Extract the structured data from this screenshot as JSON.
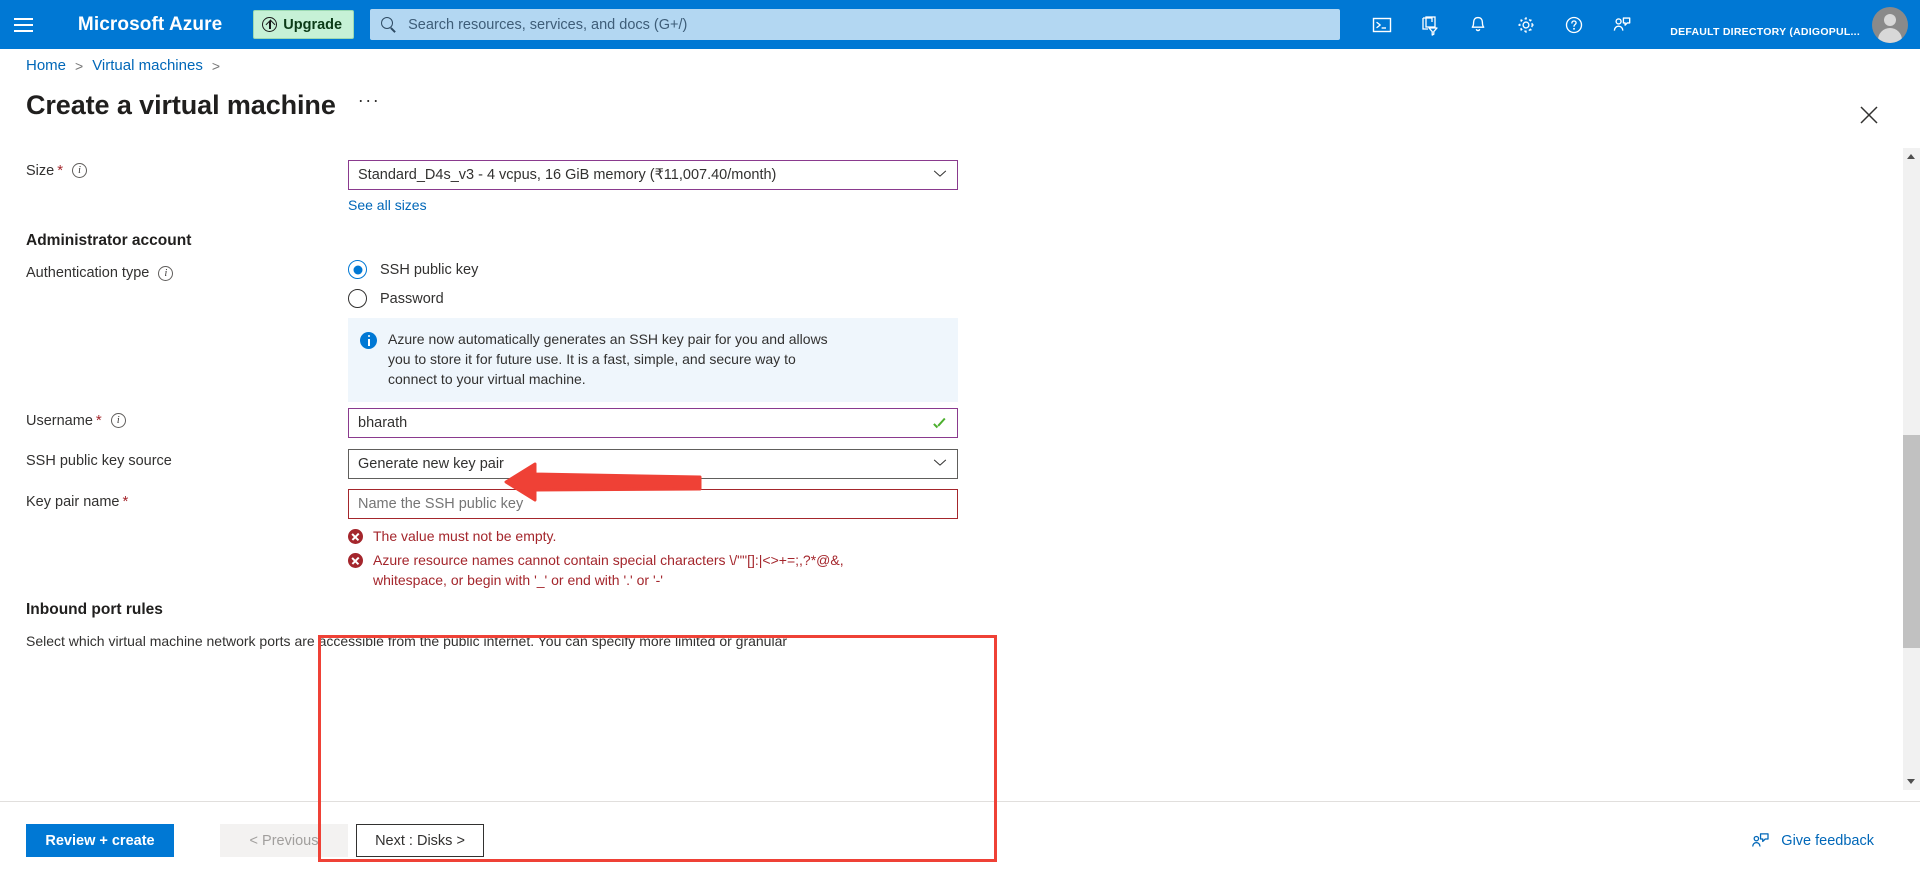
{
  "topnav": {
    "menu_icon": "hamburger-icon",
    "brand": "Microsoft Azure",
    "upgrade_label": "Upgrade",
    "search_placeholder": "Search resources, services, and docs (G+/)",
    "search_value": "",
    "icons": [
      {
        "name": "cloud-shell-icon"
      },
      {
        "name": "directories-subscriptions-icon"
      },
      {
        "name": "notifications-bell-icon"
      },
      {
        "name": "settings-gear-icon"
      },
      {
        "name": "help-question-icon"
      },
      {
        "name": "feedback-person-icon"
      }
    ],
    "directory": "DEFAULT DIRECTORY (ADIGOPUL...",
    "accent_color": "#0078d4",
    "upgrade_bg": "#c6f1d6"
  },
  "breadcrumb": {
    "items": [
      "Home",
      "Virtual machines"
    ],
    "separator": ">"
  },
  "header": {
    "title": "Create a virtual machine",
    "ellipsis": "···",
    "close_icon": "close-icon"
  },
  "form": {
    "size": {
      "label": "Size",
      "required": "*",
      "value": "Standard_D4s_v3 - 4 vcpus, 16 GiB memory (₹11,007.40/month)",
      "see_all_link": "See all sizes"
    },
    "admin_section": {
      "heading": "Administrator account",
      "auth_type_label": "Authentication type",
      "options": [
        {
          "label": "SSH public key",
          "selected": true
        },
        {
          "label": "Password",
          "selected": false
        }
      ],
      "info_message": "Azure now automatically generates an SSH key pair for you and allows you to store it for future use. It is a fast, simple, and secure way to connect to your virtual machine."
    },
    "username": {
      "label": "Username",
      "required": "*",
      "value": "bharath",
      "validation": "valid"
    },
    "ssh_source": {
      "label": "SSH public key source",
      "value": "Generate new key pair"
    },
    "key_pair_name": {
      "label": "Key pair name",
      "required": "*",
      "value": "",
      "placeholder": "Name the SSH public key",
      "errors": [
        "The value must not be empty.",
        "Azure resource names cannot contain special characters \\/\"\"[]:|<>+=;,?*@&, whitespace, or begin with '_' or end with '.' or '-'"
      ]
    },
    "inbound": {
      "heading": "Inbound port rules",
      "description": "Select which virtual machine network ports are accessible from the public internet. You can specify more limited or granular"
    }
  },
  "annotations": {
    "arrow_color": "#ef4136",
    "box_color": "#ef4136",
    "arrow_target": "SSH public key radio option",
    "box_target": "SSH key pair fields group"
  },
  "footer": {
    "review_create": "Review + create",
    "previous": "< Previous",
    "next": "Next : Disks >",
    "give_feedback": "Give feedback"
  },
  "scrollbar": {
    "up_icon": "scroll-up-arrow-icon",
    "down_icon": "scroll-down-arrow-icon"
  }
}
